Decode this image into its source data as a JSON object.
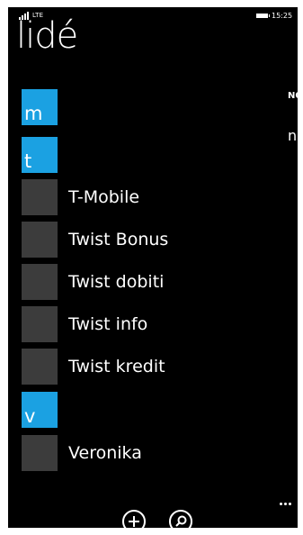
{
  "status": {
    "network": "LTE",
    "time": "15:25"
  },
  "header": {
    "title": "lidé"
  },
  "peek": {
    "label": "NO",
    "text": "na"
  },
  "groups": {
    "m": "m",
    "t": "t",
    "v": "v"
  },
  "contacts": {
    "c1": "T-Mobile",
    "c2": "Twist Bonus",
    "c3": "Twist dobiti",
    "c4": "Twist info",
    "c5": "Twist kredit",
    "c6": "Veronika"
  },
  "appbar": {
    "buttons": [
      "add-icon",
      "search-icon"
    ],
    "more": "ellipsis-icon"
  },
  "colors": {
    "accent": "#1ba1e2",
    "tile": "#3c3c3c",
    "background": "#000000",
    "text": "#ffffff"
  }
}
